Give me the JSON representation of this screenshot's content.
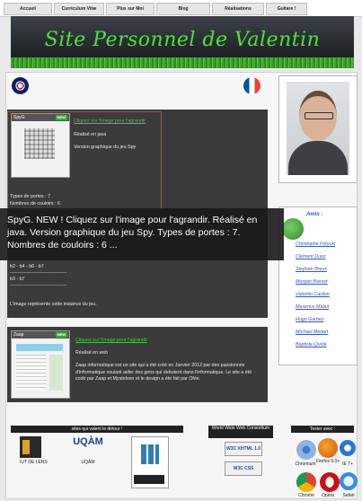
{
  "nav": {
    "items": [
      "Accueil",
      "Curriculum Vitæ",
      "Plus sur Moi",
      "Blog",
      "Réalisations",
      "Guitare !"
    ]
  },
  "banner": {
    "title": "Site Personnel de Valentin"
  },
  "languages": {
    "en_icon": "uk-flag-icon",
    "fr_icon": "france-flag-icon"
  },
  "projects": [
    {
      "thumb_title": "SpyG",
      "badge": "NEW",
      "link": "Cliquez sur l'image pour l'agrandir",
      "line1": "Réalisé en java",
      "line2": "Version graphique du jeu Spy",
      "portes": "Types de portes : 7",
      "couloirs": "Nombres de couloirs : 6",
      "paths": [
        "b2 - b4 - b6 - b7",
        "------------------------------------",
        "b3 - b7",
        "------------------------------------"
      ],
      "caption": "L'image représente cette instance du jeu."
    },
    {
      "thumb_title": "Zaap",
      "badge": "NEW",
      "link": "Cliquez sur l'image pour l'agrandir",
      "line1": "Réalisé en web",
      "description": "Zaap informatique est un site qui a été créé en Janvier 2012 par des passionnés d'informatique voulant aider des gens qui debutent dans l'informatique. Le site a été codé par Zaap et Mystelven et le design a été fait par Ofée."
    }
  ],
  "tooltip": {
    "text": "SpyG. NEW ! Cliquez sur l'image pour l'agrandir. Réalisé en java. Version graphique du jeu Spy. Types de portes : 7. Nombres de couloirs : 6 ..."
  },
  "sidebar": {
    "amis_title": "Amis :",
    "friends": [
      "Christophe Forycki",
      "Clément Duez",
      "Stephen Breux",
      "Morgan Basset",
      "Valentin Cardon",
      "Maxence Malait",
      "Hugo Garbez",
      "Michael Medart",
      "Baptiste Quidé"
    ]
  },
  "footer": {
    "sites_title": "sites qui valent le détour !",
    "sites": [
      "IUT DE LENS",
      "UQÀM"
    ],
    "w3c_title": "World Wide Web Consortium",
    "w3c_badges": [
      "W3C XHTML 1.0",
      "W3C CSS"
    ],
    "tested_title": "Tester avec :",
    "browsers": [
      "Chromium",
      "Firefox 6.0+",
      "IE 7+",
      "Chrome",
      "Opéra",
      "Safari"
    ]
  },
  "colors": {
    "accent_green": "#46c93c",
    "card_bg": "#3b3b3b",
    "link_blue": "#3355cc"
  }
}
